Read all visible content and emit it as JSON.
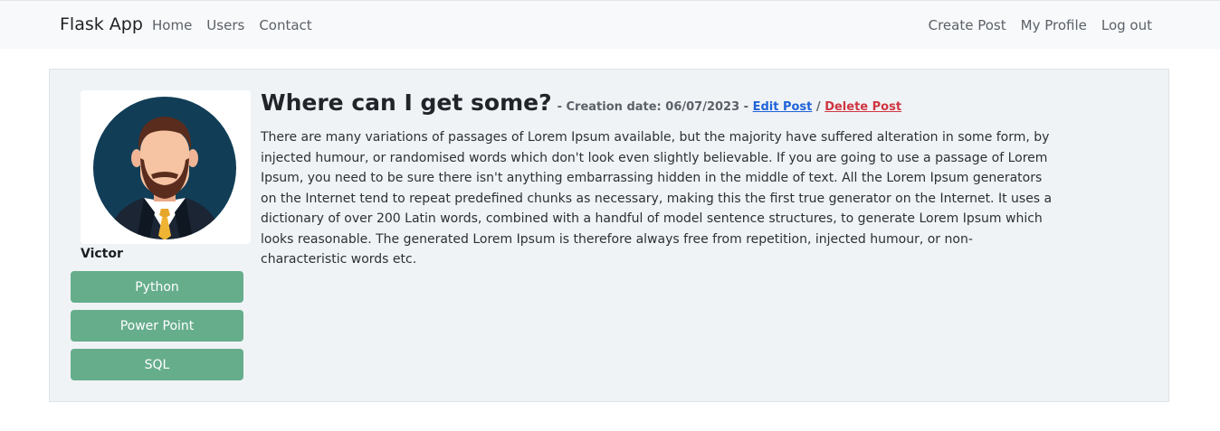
{
  "navbar": {
    "brand": "Flask App",
    "left_links": [
      "Home",
      "Users",
      "Contact"
    ],
    "right_links": [
      "Create Post",
      "My Profile",
      "Log out"
    ]
  },
  "post": {
    "title": "Where can I get some?",
    "creation_prefix": "- Creation date: 06/07/2023 -",
    "edit_label": "Edit Post",
    "separator": "/",
    "delete_label": "Delete Post",
    "body": "There are many variations of passages of Lorem Ipsum available, but the majority have suffered alteration in some form, by injected humour, or randomised words which don't look even slightly believable. If you are going to use a passage of Lorem Ipsum, you need to be sure there isn't anything embarrassing hidden in the middle of text. All the Lorem Ipsum generators on the Internet tend to repeat predefined chunks as necessary, making this the first true generator on the Internet. It uses a dictionary of over 200 Latin words, combined with a handful of model sentence structures, to generate Lorem Ipsum which looks reasonable. The generated Lorem Ipsum is therefore always free from repetition, injected humour, or non-characteristic words etc."
  },
  "author": {
    "name": "Victor",
    "avatar_icon": "businessman-avatar-icon",
    "tags": [
      "Python",
      "Power Point",
      "SQL"
    ]
  },
  "colors": {
    "navbar_bg": "#f8f9fa",
    "card_bg": "#f0f3f6",
    "tag_bg": "#66ad8c",
    "edit_link": "#1f63d8",
    "delete_link": "#cf3541"
  }
}
